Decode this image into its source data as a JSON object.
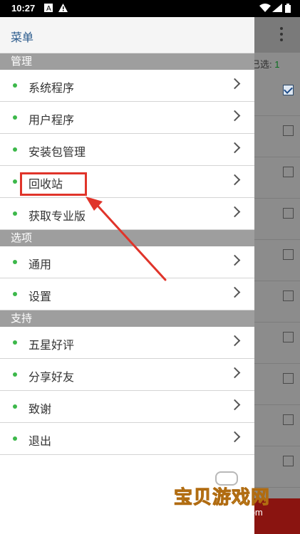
{
  "statusbar": {
    "time": "10:27"
  },
  "background": {
    "selected_label": "已选:",
    "selected_count": "1"
  },
  "drawer": {
    "title": "菜单",
    "sections": [
      {
        "header": "管理",
        "items": [
          "系统程序",
          "用户程序",
          "安装包管理",
          "回收站",
          "获取专业版"
        ]
      },
      {
        "header": "选项",
        "items": [
          "通用",
          "设置"
        ]
      },
      {
        "header": "支持",
        "items": [
          "五星好评",
          "分享好友",
          "致谢",
          "退出"
        ]
      }
    ]
  },
  "annotation": {
    "highlight_color": "#e0342a"
  },
  "watermark": {
    "main_text": "宝贝游戏网",
    "sub_text": "baobeiy.com"
  }
}
